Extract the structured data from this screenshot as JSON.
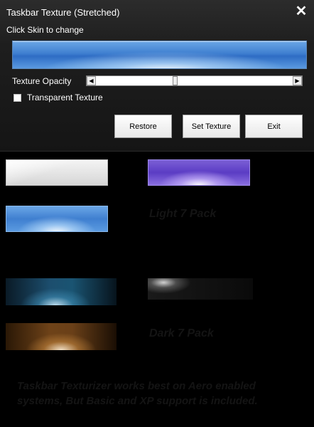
{
  "window": {
    "title": "Taskbar Texture (Stretched)",
    "close_glyph": "✕"
  },
  "editor": {
    "instruction": "Click Skin to change",
    "opacity_label": "Texture Opacity",
    "opacity_value": 0.4,
    "transparent_label": "Transparent Texture",
    "transparent_checked": false
  },
  "buttons": {
    "restore": "Restore",
    "set_texture": "Set Texture",
    "exit": "Exit"
  },
  "skins": {
    "light_pack_label": "Light 7 Pack",
    "dark_pack_label": "Dark 7 Pack",
    "items": [
      {
        "name": "silver",
        "color": "#e6e6e6"
      },
      {
        "name": "purple",
        "color": "#6a4fd0"
      },
      {
        "name": "blue",
        "color": "#3f7fd0"
      },
      {
        "name": "teal",
        "color": "#1c4e6e"
      },
      {
        "name": "dark",
        "color": "#1a1a1a"
      },
      {
        "name": "amber",
        "color": "#6e4218"
      }
    ]
  },
  "footer": {
    "note": "Taskbar Texturizer works best on Aero enabled systems, But Basic and XP support is included."
  },
  "colors": {
    "background": "#000000",
    "panel": "#1e1e1e",
    "dim_text": "#141414"
  }
}
